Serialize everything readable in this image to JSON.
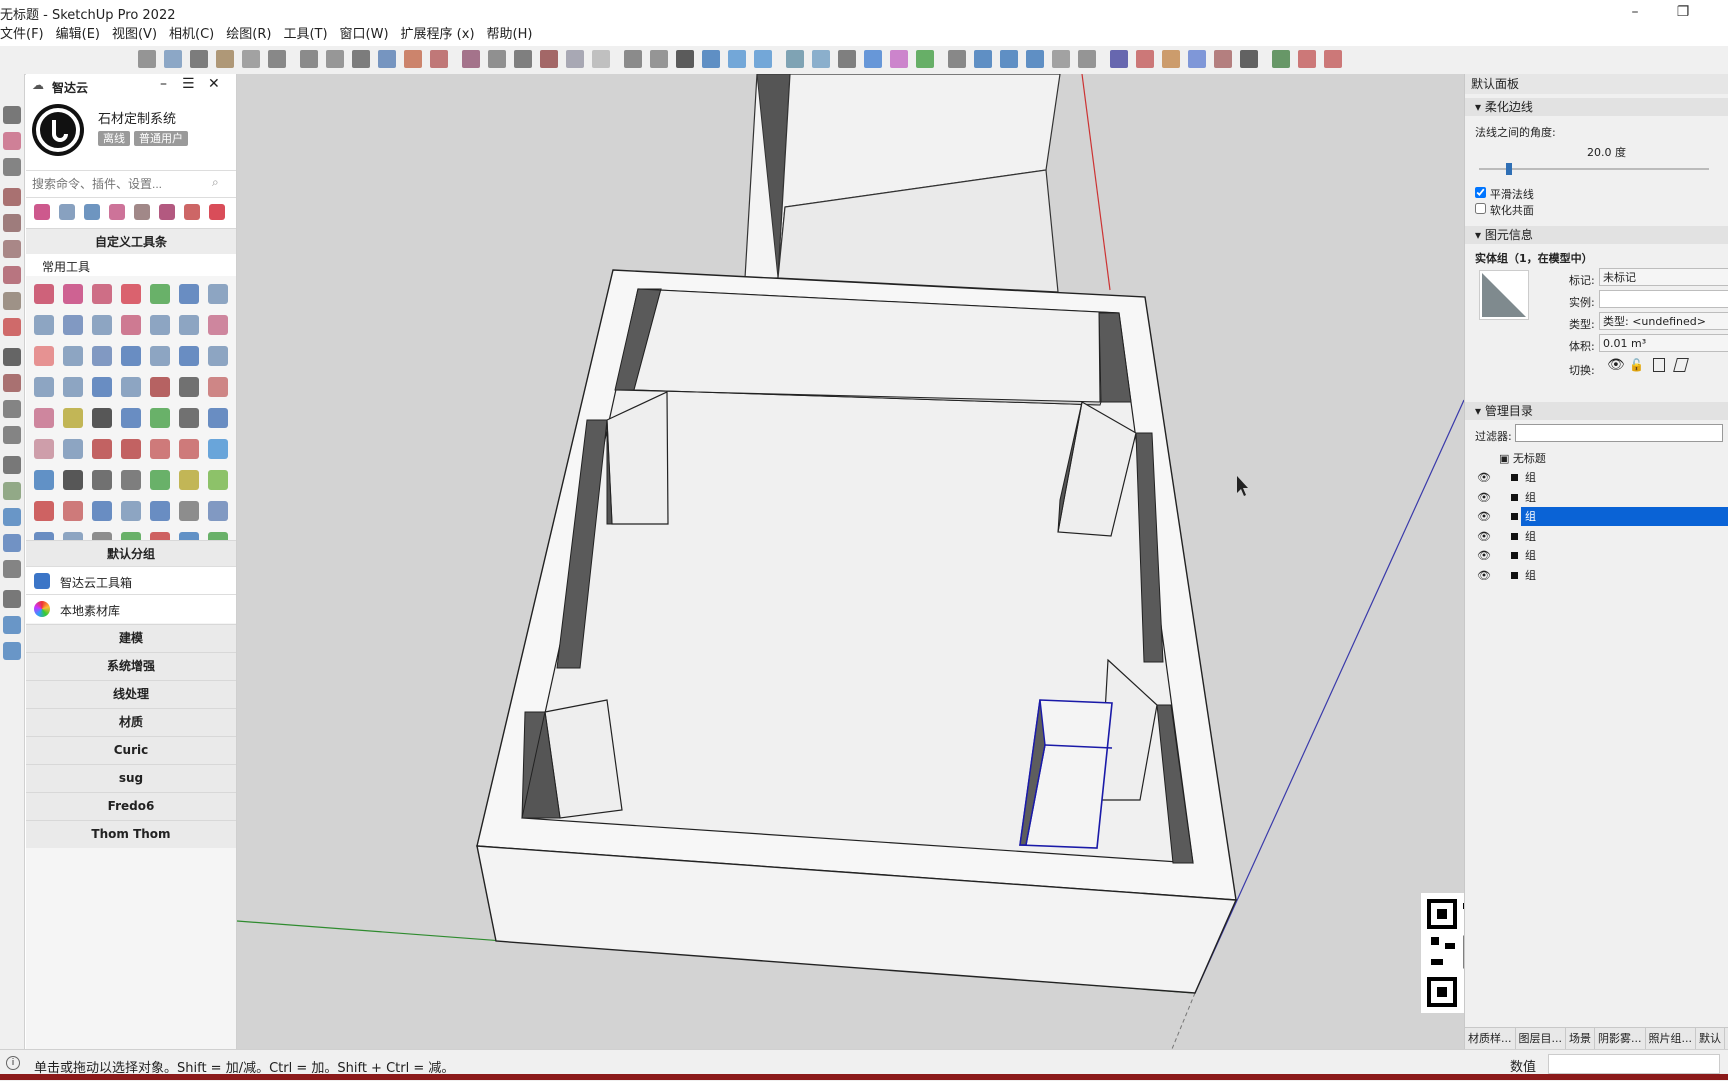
{
  "window": {
    "title": "无标题 - SketchUp Pro 2022",
    "min": "–",
    "restore": "❐"
  },
  "menu": [
    "文件(F)",
    "编辑(E)",
    "视图(V)",
    "相机(C)",
    "绘图(R)",
    "工具(T)",
    "窗口(W)",
    "扩展程序 (x)",
    "帮助(H)"
  ],
  "plugin": {
    "title": "智达云",
    "system_name": "石材定制系统",
    "badge_offline": "离线",
    "badge_user": "普通用户",
    "search_placeholder": "搜索命令、插件、设置...",
    "custom_toolbar": "自定义工具条",
    "common_tools": "常用工具",
    "default_group": "默认分组",
    "toolbox": "智达云工具箱",
    "material_lib": "本地素材库",
    "sections": [
      "建模",
      "系统增强",
      "线处理",
      "材质",
      "Curic",
      "sug",
      "Fredo6",
      "Thom Thom"
    ]
  },
  "right": {
    "panel_title": "默认面板",
    "soften": {
      "title": "柔化边线",
      "angle_label": "法线之间的角度:",
      "angle_value": "20.0 度",
      "angle_fraction": 0.13,
      "smooth_label": "平滑法线",
      "smooth_checked": true,
      "coplanar_label": "软化共面",
      "coplanar_checked": false
    },
    "entity": {
      "title": "图元信息",
      "heading": "实体组（1，在模型中）",
      "tag_label": "标记:",
      "tag_value": "未标记",
      "instance_label": "实例:",
      "instance_value": "",
      "type_label": "类型:",
      "type_value": "类型: <undefined>",
      "volume_label": "体积:",
      "volume_value": "0.01 m³",
      "toggle_label": "切换:"
    },
    "outliner": {
      "title": "管理目录",
      "filter_label": "过滤器:",
      "filter_value": "",
      "root": "无标题",
      "items": [
        "组",
        "组",
        "组",
        "组",
        "组",
        "组"
      ],
      "selected_index": 2
    },
    "tabs": [
      "材质样...",
      "图层目...",
      "场景",
      "阴影雾...",
      "照片组...",
      "默认"
    ]
  },
  "status": {
    "hint": "单击或拖动以选择对象。Shift = 加/减。Ctrl = 加。Shift + Ctrl = 减。",
    "measure_label": "数值"
  },
  "colors": {
    "selection": "#0a63d6",
    "axis_red": "#cc3333",
    "axis_green": "#2e8b2e",
    "axis_blue": "#3a3aaa"
  }
}
